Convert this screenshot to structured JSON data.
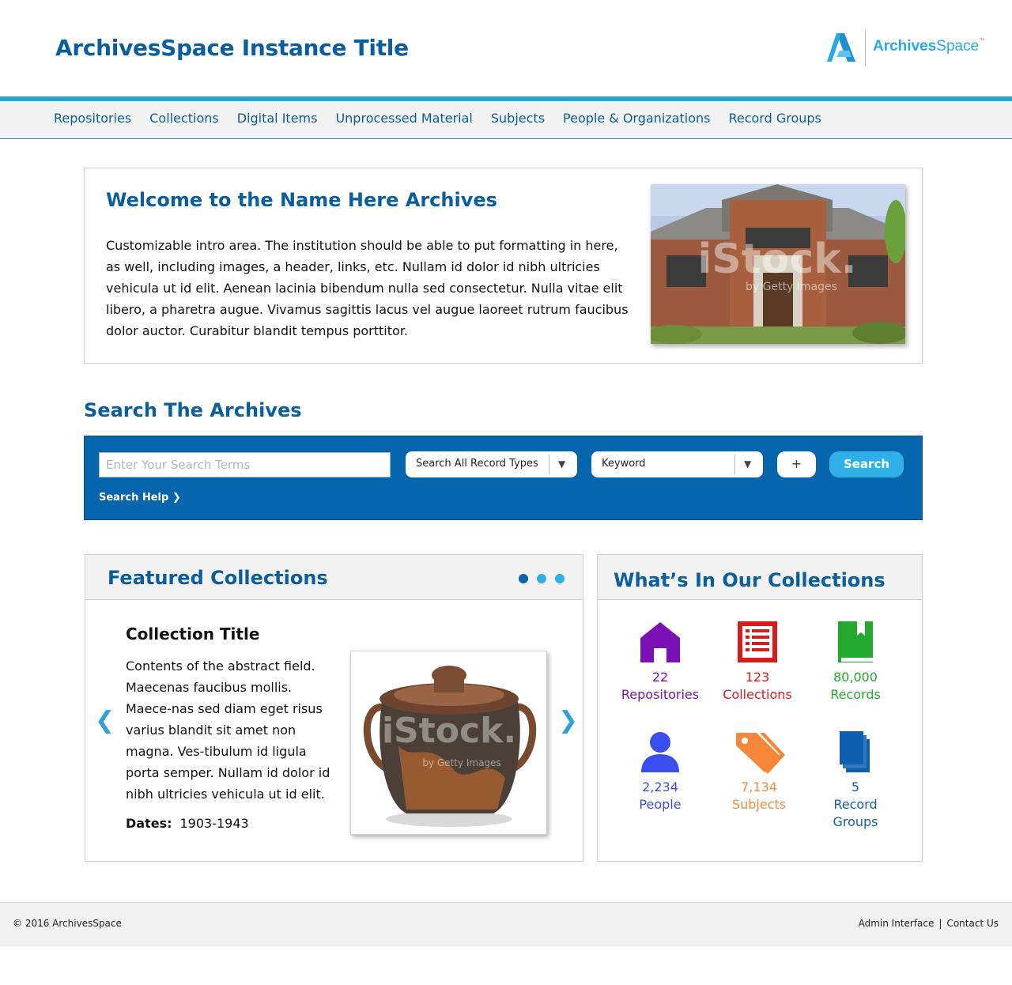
{
  "header": {
    "site_title": "ArchivesSpace Instance Title",
    "logo": {
      "word_bold": "Archives",
      "word_light": "Space",
      "tm": "™"
    }
  },
  "nav": {
    "items": [
      {
        "label": "Repositories"
      },
      {
        "label": "Collections"
      },
      {
        "label": "Digital Items"
      },
      {
        "label": "Unprocessed Material"
      },
      {
        "label": "Subjects"
      },
      {
        "label": "People & Organizations"
      },
      {
        "label": "Record Groups"
      }
    ]
  },
  "welcome": {
    "title": "Welcome to the Name Here Archives",
    "body": "Customizable intro area. The institution should be able to put formatting in here, as well, including images, a header, links, etc. Nullam id dolor id nibh ultricies vehicula ut id elit. Aenean lacinia bibendum nulla sed consectetur. Nulla vitae elit libero, a pharetra augue. Vivamus sagittis lacus vel augue laoreet rutrum faucibus dolor auctor. Curabitur blandit tempus porttitor.",
    "image_watermark": "iStock.",
    "image_watermark_sub": "by Getty Images"
  },
  "search": {
    "title": "Search The Archives",
    "input_placeholder": "Enter Your Search Terms",
    "record_type_selected": "Search All Record Types",
    "field_selected": "Keyword",
    "add_label": "+",
    "button_label": "Search",
    "help_label": "Search Help ❯"
  },
  "featured": {
    "title": "Featured Collections",
    "slide_count": 3,
    "active_slide": 1,
    "prev_label": "❮",
    "next_label": "❯",
    "collection_title": "Collection Title",
    "abstract": "Contents of the abstract field. Maecenas faucibus mollis. Maece-nas sed diam eget risus varius blandit sit amet non magna. Ves-tibulum id ligula porta semper. Nullam id dolor id nibh ultricies vehicula ut id elit.",
    "dates_label": "Dates:",
    "dates_value": "1903-1943",
    "image_watermark": "iStock.",
    "image_watermark_sub": "by Getty Images"
  },
  "stats": {
    "title": "What’s In Our Collections",
    "items": [
      {
        "count": "22",
        "label": "Repositories",
        "icon": "house-icon",
        "color": "#7b10b5"
      },
      {
        "count": "123",
        "label": "Collections",
        "icon": "list-document-icon",
        "color": "#d81b1b"
      },
      {
        "count": "80,000",
        "label": "Records",
        "icon": "book-icon",
        "color": "#23a92d"
      },
      {
        "count": "2,234",
        "label": "People",
        "icon": "person-icon",
        "color": "#3a4ef0"
      },
      {
        "count": "7,134",
        "label": "Subjects",
        "icon": "tags-icon",
        "color": "#f5873a"
      },
      {
        "count": "5",
        "label": "Record Groups",
        "icon": "stacked-pages-icon",
        "color": "#0f5fb0"
      }
    ]
  },
  "footer": {
    "copyright": "© 2016 ArchivesSpace",
    "admin_link": "Admin Interface",
    "separator": "|",
    "contact_link": "Contact Us"
  },
  "colors": {
    "brand_blue": "#0b5e9e",
    "search_panel": "#0565ad",
    "accent": "#2fb0e6"
  }
}
